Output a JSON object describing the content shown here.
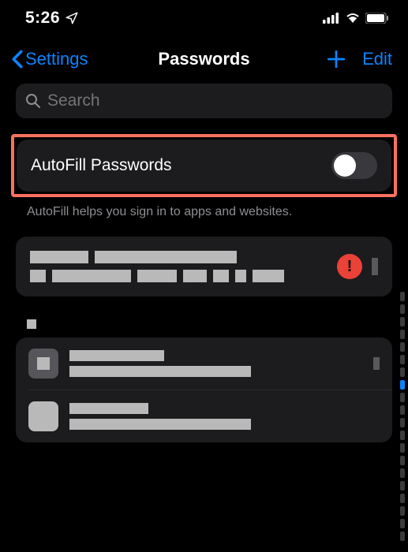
{
  "status": {
    "time": "5:26"
  },
  "nav": {
    "back_label": "Settings",
    "title": "Passwords",
    "edit_label": "Edit"
  },
  "search": {
    "placeholder": "Search"
  },
  "autofill": {
    "label": "AutoFill Passwords",
    "enabled": false,
    "helper": "AutoFill helps you sign in to apps and websites."
  },
  "warning_badge": "!"
}
